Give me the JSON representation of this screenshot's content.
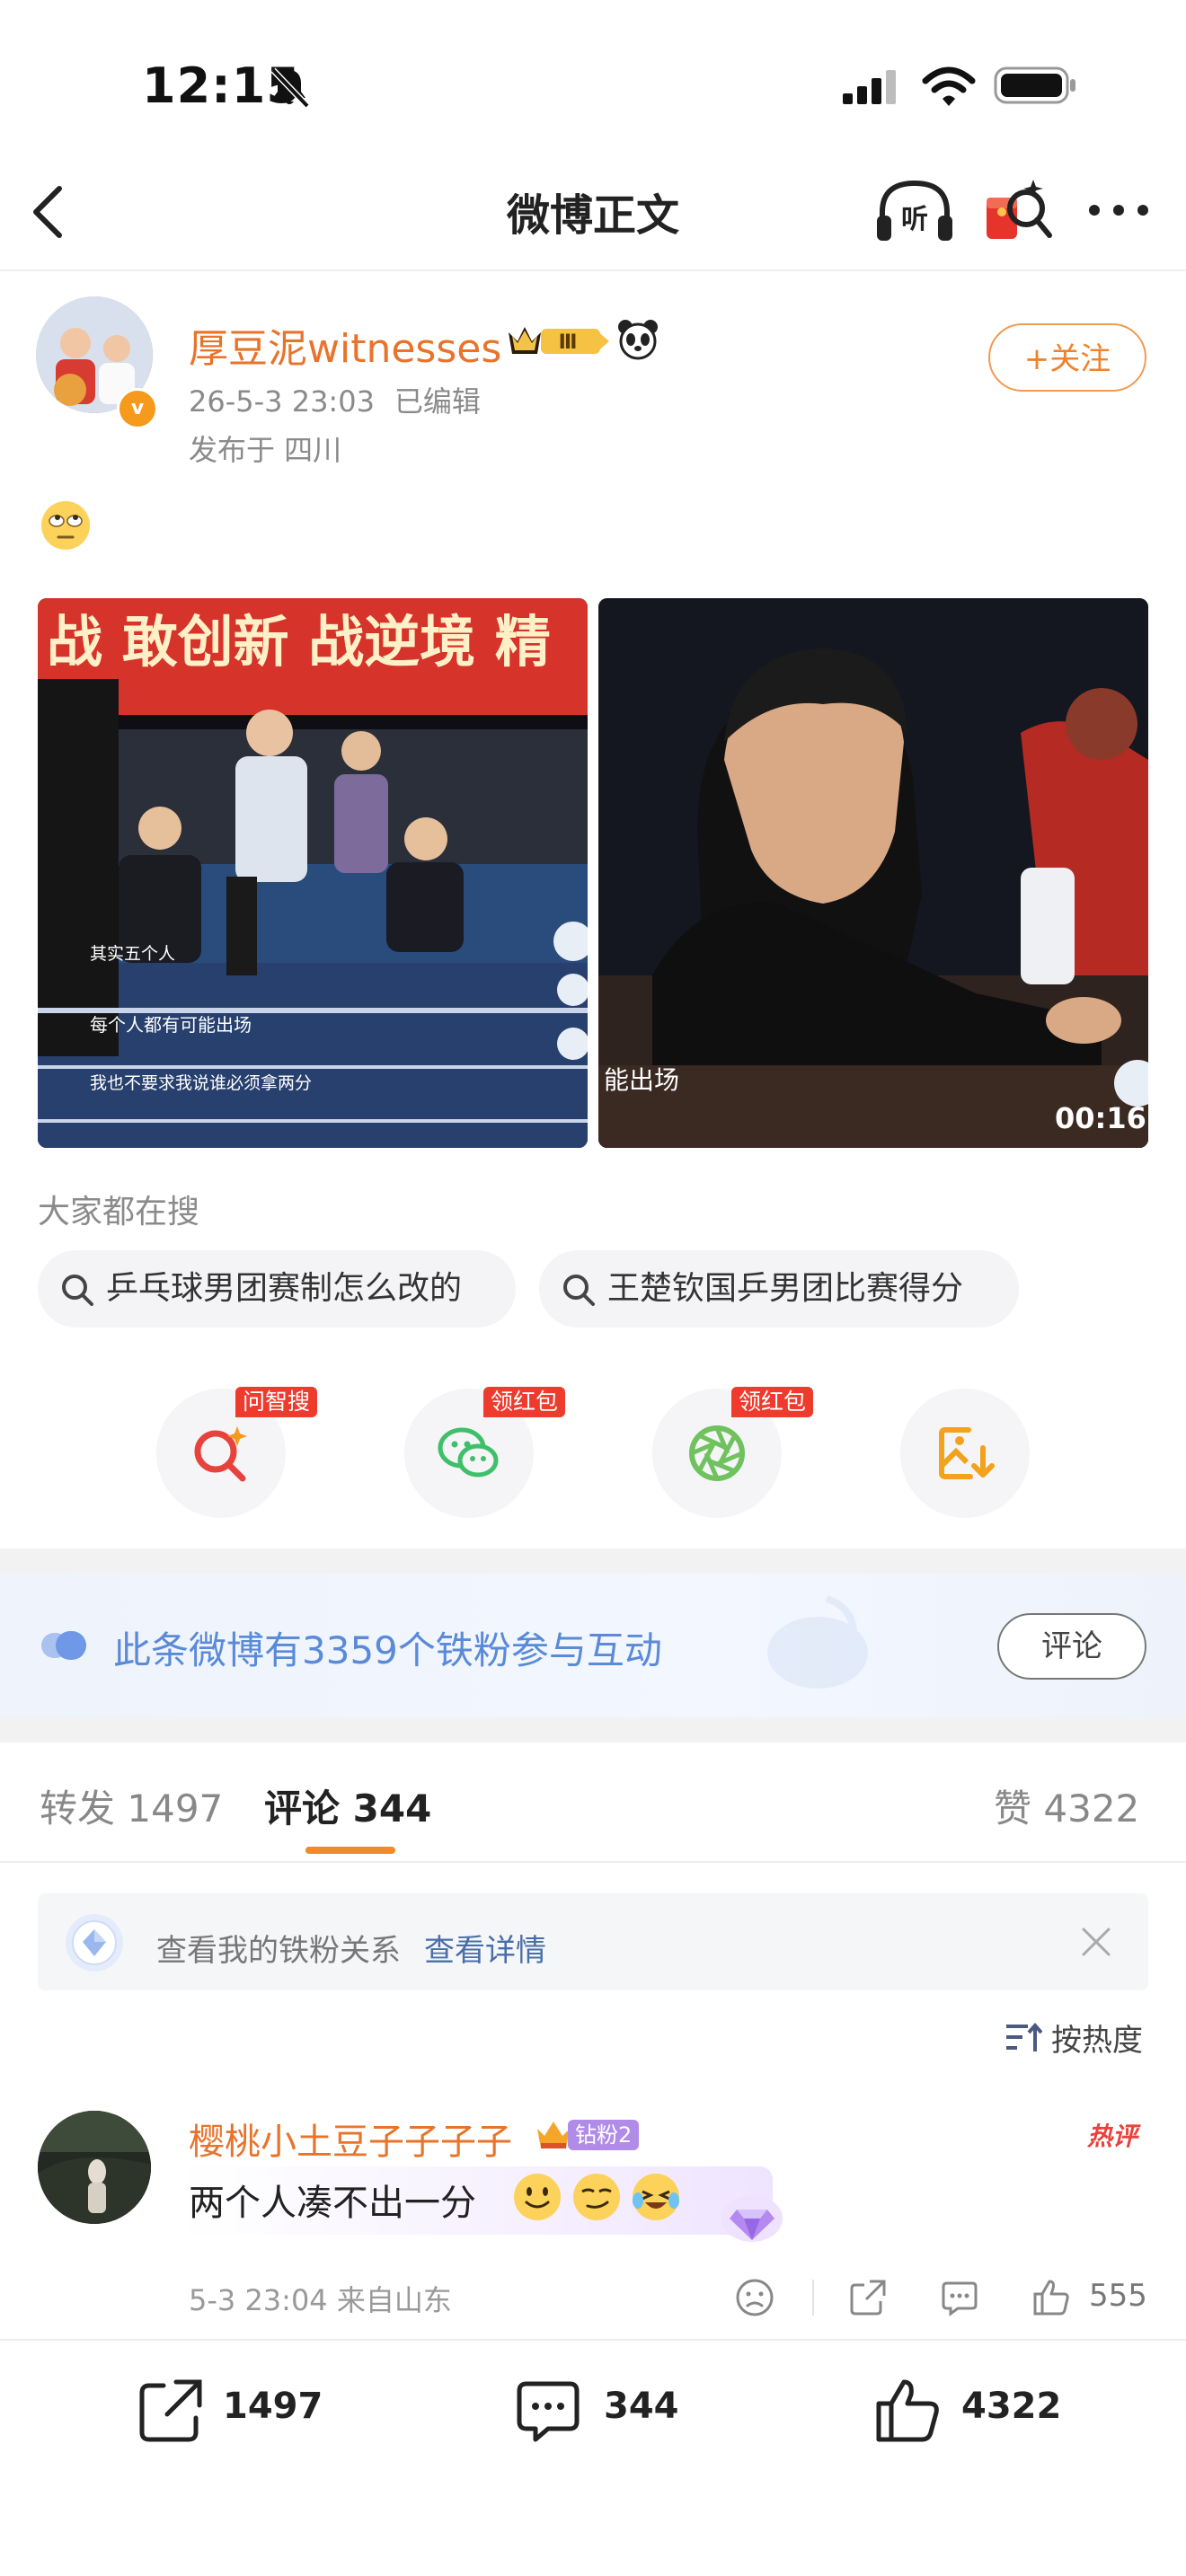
{
  "status_bar": {
    "time": "12:15"
  },
  "nav": {
    "title": "微博正文"
  },
  "post": {
    "author": "厚豆泥witnesses",
    "vip_level": "Ⅲ",
    "time": "26-5-3 23:03",
    "edited": "已编辑",
    "location": "发布于 四川",
    "follow_label": "+关注",
    "verified_badge": "v",
    "video_duration": "00:16",
    "img1_captions": [
      "战 敢创新 战逆境 精",
      "其实五个人",
      "每个人都有可能出场",
      "我也不要求我说谁必须拿两分"
    ],
    "img2_caption": "能出场"
  },
  "search": {
    "header": "大家都在搜",
    "chips": [
      "乒乓球男团赛制怎么改的",
      "王楚钦国乒男团比赛得分"
    ]
  },
  "share_actions": {
    "tags": [
      "问智搜",
      "领红包",
      "领红包"
    ]
  },
  "fan_banner": {
    "text": "此条微博有3359个铁粉参与互动",
    "button": "评论"
  },
  "tabs": {
    "repost_label": "转发",
    "repost_count": "1497",
    "comment_label": "评论",
    "comment_count": "344",
    "like_label": "赞",
    "like_count": "4322"
  },
  "fan_relation": {
    "text": "查看我的铁粉关系",
    "link": "查看详情"
  },
  "sort": {
    "label": "按热度"
  },
  "comment": {
    "user": "樱桃小土豆子子子子",
    "fan_badge": "钻粉2",
    "text": "两个人凑不出一分",
    "hot_label": "热评",
    "time_loc": "5-3 23:04 来自山东",
    "likes": "555"
  },
  "bottom_bar": {
    "reposts": "1497",
    "comments": "344",
    "likes": "4322"
  },
  "colors": {
    "accent_orange": "#e8732b",
    "link_blue": "#4a6ea8",
    "fan_blue": "#5a8ad8",
    "tag_red": "#ef3b2d"
  }
}
